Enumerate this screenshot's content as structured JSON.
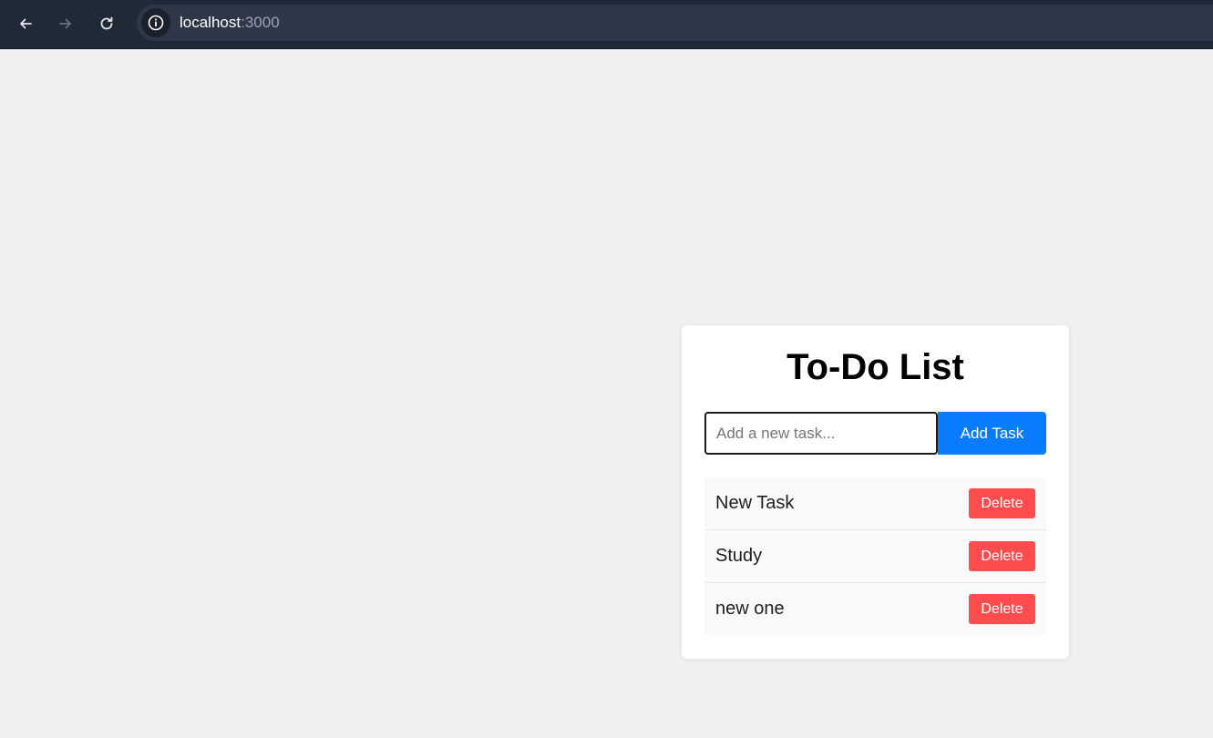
{
  "browser": {
    "url_host": "localhost",
    "url_port": ":3000"
  },
  "app": {
    "title": "To-Do List",
    "input_placeholder": "Add a new task...",
    "input_value": "",
    "add_label": "Add Task",
    "delete_label": "Delete",
    "accent_color": "#0a7cff",
    "delete_color": "#ff4d4f",
    "tasks": [
      {
        "text": "New Task"
      },
      {
        "text": "Study"
      },
      {
        "text": "new one"
      }
    ]
  }
}
